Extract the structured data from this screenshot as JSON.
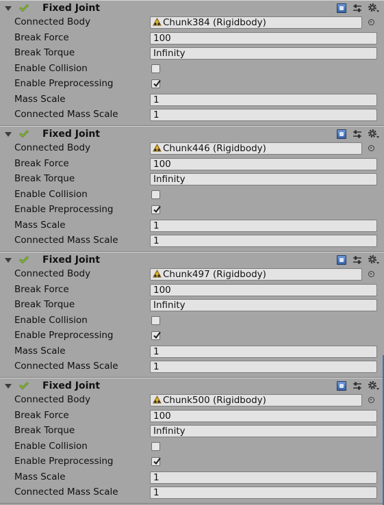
{
  "components": [
    {
      "title": "Fixed Joint",
      "connected_body": "Chunk384 (Rigidbody)",
      "break_force": "100",
      "break_torque": "Infinity",
      "enable_collision": false,
      "enable_preprocessing": true,
      "mass_scale": "1",
      "connected_mass_scale": "1"
    },
    {
      "title": "Fixed Joint",
      "connected_body": "Chunk446 (Rigidbody)",
      "break_force": "100",
      "break_torque": "Infinity",
      "enable_collision": false,
      "enable_preprocessing": true,
      "mass_scale": "1",
      "connected_mass_scale": "1"
    },
    {
      "title": "Fixed Joint",
      "connected_body": "Chunk497 (Rigidbody)",
      "break_force": "100",
      "break_torque": "Infinity",
      "enable_collision": false,
      "enable_preprocessing": true,
      "mass_scale": "1",
      "connected_mass_scale": "1"
    },
    {
      "title": "Fixed Joint",
      "connected_body": "Chunk500 (Rigidbody)",
      "break_force": "100",
      "break_torque": "Infinity",
      "enable_collision": false,
      "enable_preprocessing": true,
      "mass_scale": "1",
      "connected_mass_scale": "1"
    }
  ],
  "labels": {
    "connected_body": "Connected Body",
    "break_force": "Break Force",
    "break_torque": "Break Torque",
    "enable_collision": "Enable Collision",
    "enable_preprocessing": "Enable Preprocessing",
    "mass_scale": "Mass Scale",
    "connected_mass_scale": "Connected Mass Scale"
  },
  "icons": {
    "foldout": "foldout-arrow-icon",
    "joint": "fixed-joint-icon",
    "help": "help-book-icon",
    "preset": "preset-sliders-icon",
    "settings": "gear-icon",
    "picker": "object-picker-icon",
    "rigidbody": "rigidbody-icon"
  },
  "colors": {
    "background": "#a5a5a5",
    "field": "#e3e3e3",
    "help_blue": "#3a63a3",
    "check_green": "#5a8a1e"
  }
}
